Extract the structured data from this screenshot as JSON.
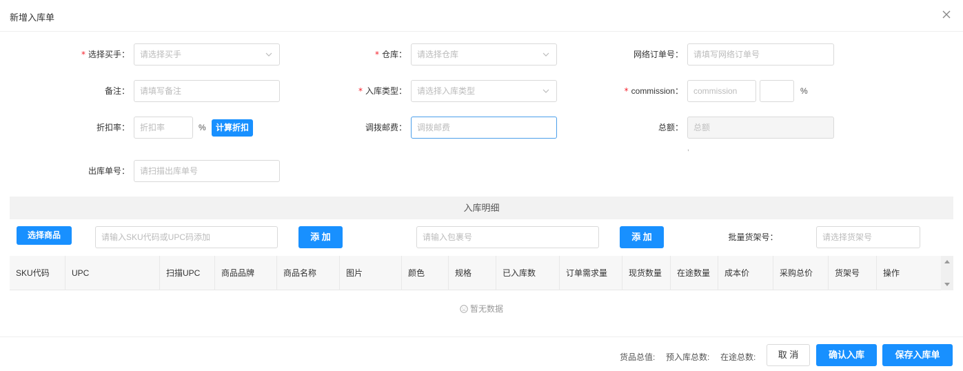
{
  "dialog": {
    "title": "新增入库单"
  },
  "form": {
    "buyer": {
      "label": "选择买手：",
      "placeholder": "请选择买手"
    },
    "warehouse": {
      "label": "仓库：",
      "placeholder": "请选择仓库"
    },
    "online_order": {
      "label": "网络订单号：",
      "placeholder": "请填写网络订单号"
    },
    "remark": {
      "label": "备注：",
      "placeholder": "请填写备注"
    },
    "inbound_type": {
      "label": "入库类型：",
      "placeholder": "请选择入库类型"
    },
    "commission": {
      "label": "commission：",
      "placeholder": "commission",
      "percent_value": "",
      "percent_sign": "%"
    },
    "discount": {
      "label": "折扣率：",
      "placeholder": "折扣率",
      "percent_sign": "%",
      "button": "计算折扣"
    },
    "transfer_postage": {
      "label": "调拨邮费：",
      "placeholder": "调拨邮费"
    },
    "total": {
      "label": "总额：",
      "placeholder": "总额",
      "note": ","
    },
    "outbound_no": {
      "label": "出库单号：",
      "placeholder": "请扫描出库单号"
    }
  },
  "detail": {
    "section_title": "入库明细",
    "select_goods_button": "选择商品",
    "sku_input_placeholder": "请输入SKU代码或UPC码添加",
    "add_button_1": "添 加",
    "package_input_placeholder": "请输入包裹号",
    "add_button_2": "添 加",
    "batch_shelf_label": "批量货架号：",
    "batch_shelf_placeholder": "请选择货架号",
    "columns": [
      "SKU代码",
      "UPC",
      "扫描UPC",
      "商品品牌",
      "商品名称",
      "图片",
      "颜色",
      "规格",
      "已入库数",
      "订单需求量",
      "现货数量",
      "在途数量",
      "成本价",
      "采购总价",
      "货架号",
      "操作"
    ],
    "empty_text": "暂无数据"
  },
  "footer": {
    "goods_total_label": "货品总值:",
    "pre_inbound_label": "预入库总数:",
    "in_transit_label": "在途总数:",
    "cancel_button": "取 消",
    "confirm_button": "确认入库",
    "save_button": "保存入库单"
  },
  "colors": {
    "primary": "#1890ff",
    "required": "#f5222d",
    "focus_border": "#4a9eea"
  }
}
